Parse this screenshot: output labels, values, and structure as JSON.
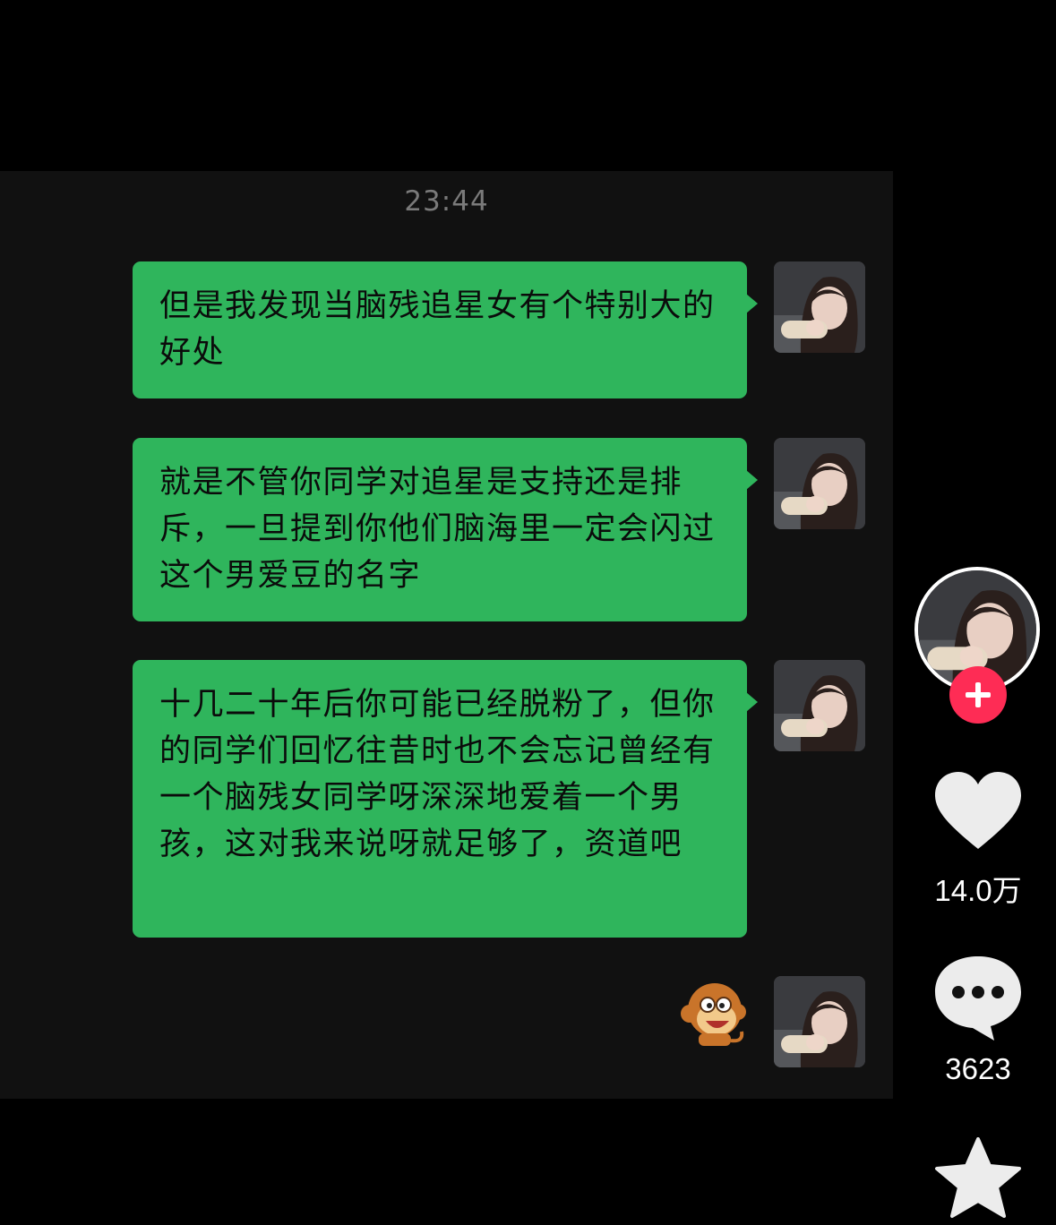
{
  "chat": {
    "timestamp": "23:44",
    "messages": [
      {
        "text": "但是我发现当脑残追星女有个特别大的好处"
      },
      {
        "text": "就是不管你同学对追星是支持还是排斥，一旦提到你他们脑海里一定会闪过这个男爱豆的名字"
      },
      {
        "text": "十几二十年后你可能已经脱粉了，但你的同学们回忆往昔时也不会忘记曾经有一个脑残女同学呀深深地爱着一个男孩，这对我来说呀就足够了，资道吧"
      }
    ],
    "sticker": "monkey-emoji-sticker"
  },
  "sidebar": {
    "like_count": "14.0万",
    "comment_count": "3623",
    "icons": [
      "heart-icon",
      "comment-icon",
      "star-icon",
      "plus-icon"
    ],
    "colors": {
      "follow": "#fe2c55",
      "bubble": "#2fb55c"
    }
  }
}
